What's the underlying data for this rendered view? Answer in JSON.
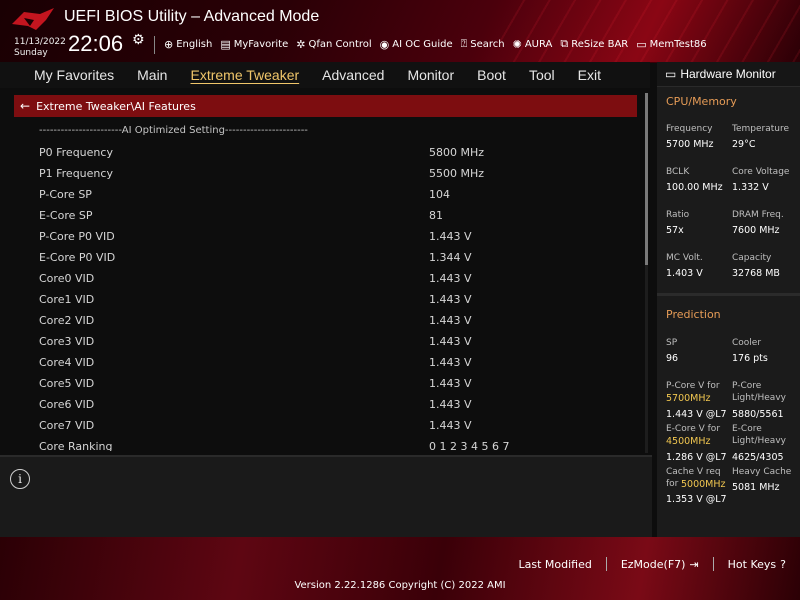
{
  "header": {
    "title": "UEFI BIOS Utility – Advanced Mode",
    "date": "11/13/2022",
    "day": "Sunday",
    "time": "22:06",
    "tools": [
      {
        "icon": "globe-icon",
        "label": "English"
      },
      {
        "icon": "favorite-icon",
        "label": "MyFavorite"
      },
      {
        "icon": "fan-icon",
        "label": "Qfan Control"
      },
      {
        "icon": "ai-icon",
        "label": "AI OC Guide"
      },
      {
        "icon": "search-icon",
        "label": "Search"
      },
      {
        "icon": "aura-icon",
        "label": "AURA"
      },
      {
        "icon": "resize-icon",
        "label": "ReSize BAR"
      },
      {
        "icon": "memtest-icon",
        "label": "MemTest86"
      }
    ]
  },
  "menu": [
    "My Favorites",
    "Main",
    "Extreme Tweaker",
    "Advanced",
    "Monitor",
    "Boot",
    "Tool",
    "Exit"
  ],
  "active_menu": "Extreme Tweaker",
  "breadcrumb": "Extreme Tweaker\\AI Features",
  "section_title": "-----------------------AI Optimized Setting-----------------------",
  "rows": [
    {
      "label": "P0 Frequency",
      "value": "5800 MHz"
    },
    {
      "label": "P1 Frequency",
      "value": "5500 MHz"
    },
    {
      "label": "P-Core SP",
      "value": "104"
    },
    {
      "label": "E-Core SP",
      "value": "81"
    },
    {
      "label": "P-Core P0 VID",
      "value": "1.443 V"
    },
    {
      "label": "E-Core P0 VID",
      "value": "1.344 V"
    },
    {
      "label": "Core0 VID",
      "value": "1.443 V"
    },
    {
      "label": "Core1 VID",
      "value": "1.443 V"
    },
    {
      "label": "Core2 VID",
      "value": "1.443 V"
    },
    {
      "label": "Core3 VID",
      "value": "1.443 V"
    },
    {
      "label": "Core4 VID",
      "value": "1.443 V"
    },
    {
      "label": "Core5 VID",
      "value": "1.443 V"
    },
    {
      "label": "Core6 VID",
      "value": "1.443 V"
    },
    {
      "label": "Core7 VID",
      "value": "1.443 V"
    },
    {
      "label": "Core Ranking",
      "value": "0 1 2 3 4 5 6 7"
    }
  ],
  "hardware_monitor": {
    "title": "Hardware Monitor",
    "cpu_memory": {
      "heading": "CPU/Memory",
      "items": [
        {
          "label": "Frequency",
          "value": "5700 MHz"
        },
        {
          "label": "Temperature",
          "value": "29°C"
        },
        {
          "label": "BCLK",
          "value": "100.00 MHz"
        },
        {
          "label": "Core Voltage",
          "value": "1.332 V"
        },
        {
          "label": "Ratio",
          "value": "57x"
        },
        {
          "label": "DRAM Freq.",
          "value": "7600 MHz"
        },
        {
          "label": "MC Volt.",
          "value": "1.403 V"
        },
        {
          "label": "Capacity",
          "value": "32768 MB"
        }
      ]
    },
    "prediction": {
      "heading": "Prediction",
      "sp_label": "SP",
      "sp_value": "96",
      "cooler_label": "Cooler",
      "cooler_value": "176 pts",
      "pcore_v_label": "P-Core V for",
      "pcore_v_freq": "5700MHz",
      "pcore_v_value": "1.443 V @L7",
      "pcore_lh_label1": "P-Core",
      "pcore_lh_label2": "Light/Heavy",
      "pcore_lh_value": "5880/5561",
      "ecore_v_label": "E-Core V for",
      "ecore_v_freq": "4500MHz",
      "ecore_v_value": "1.286 V @L7",
      "ecore_lh_label1": "E-Core",
      "ecore_lh_label2": "Light/Heavy",
      "ecore_lh_value": "4625/4305",
      "cache_v_label1": "Cache V req",
      "cache_v_label2": "for",
      "cache_v_freq": "5000MHz",
      "cache_v_value": "1.353 V @L7",
      "heavy_cache_label": "Heavy Cache",
      "heavy_cache_value": "5081 MHz"
    }
  },
  "footer": {
    "last_modified": "Last Modified",
    "ezmode": "EzMode(F7)",
    "hot_keys": "Hot Keys",
    "version": "Version 2.22.1286 Copyright (C) 2022 AMI"
  },
  "colors": {
    "accent": "#f0c66a",
    "breadcrumb_bg": "#7d0d10",
    "section_orange": "#e59b56"
  }
}
